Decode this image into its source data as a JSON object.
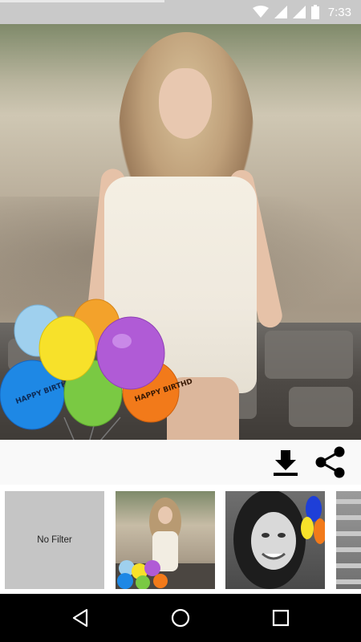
{
  "status_bar": {
    "time": "7:33",
    "icons": [
      "wifi-icon",
      "signal-icon",
      "signal-icon",
      "battery-icon"
    ]
  },
  "photo": {
    "subject": "photo-with-birthday-balloons",
    "balloon_text": "HAPPY BIRTHDAY"
  },
  "toolbar": {
    "download_icon": "download-icon",
    "share_icon": "share-icon"
  },
  "filters": {
    "items": [
      {
        "label": "No Filter"
      },
      {
        "label": ""
      },
      {
        "label": ""
      },
      {
        "label": ""
      }
    ]
  },
  "nav": {
    "icons": [
      "back-icon",
      "home-icon",
      "recents-icon"
    ]
  },
  "colors": {
    "status_bar": "#c9c9c9",
    "nav_bar": "#000000",
    "no_filter_bg": "#c5c5c5"
  }
}
